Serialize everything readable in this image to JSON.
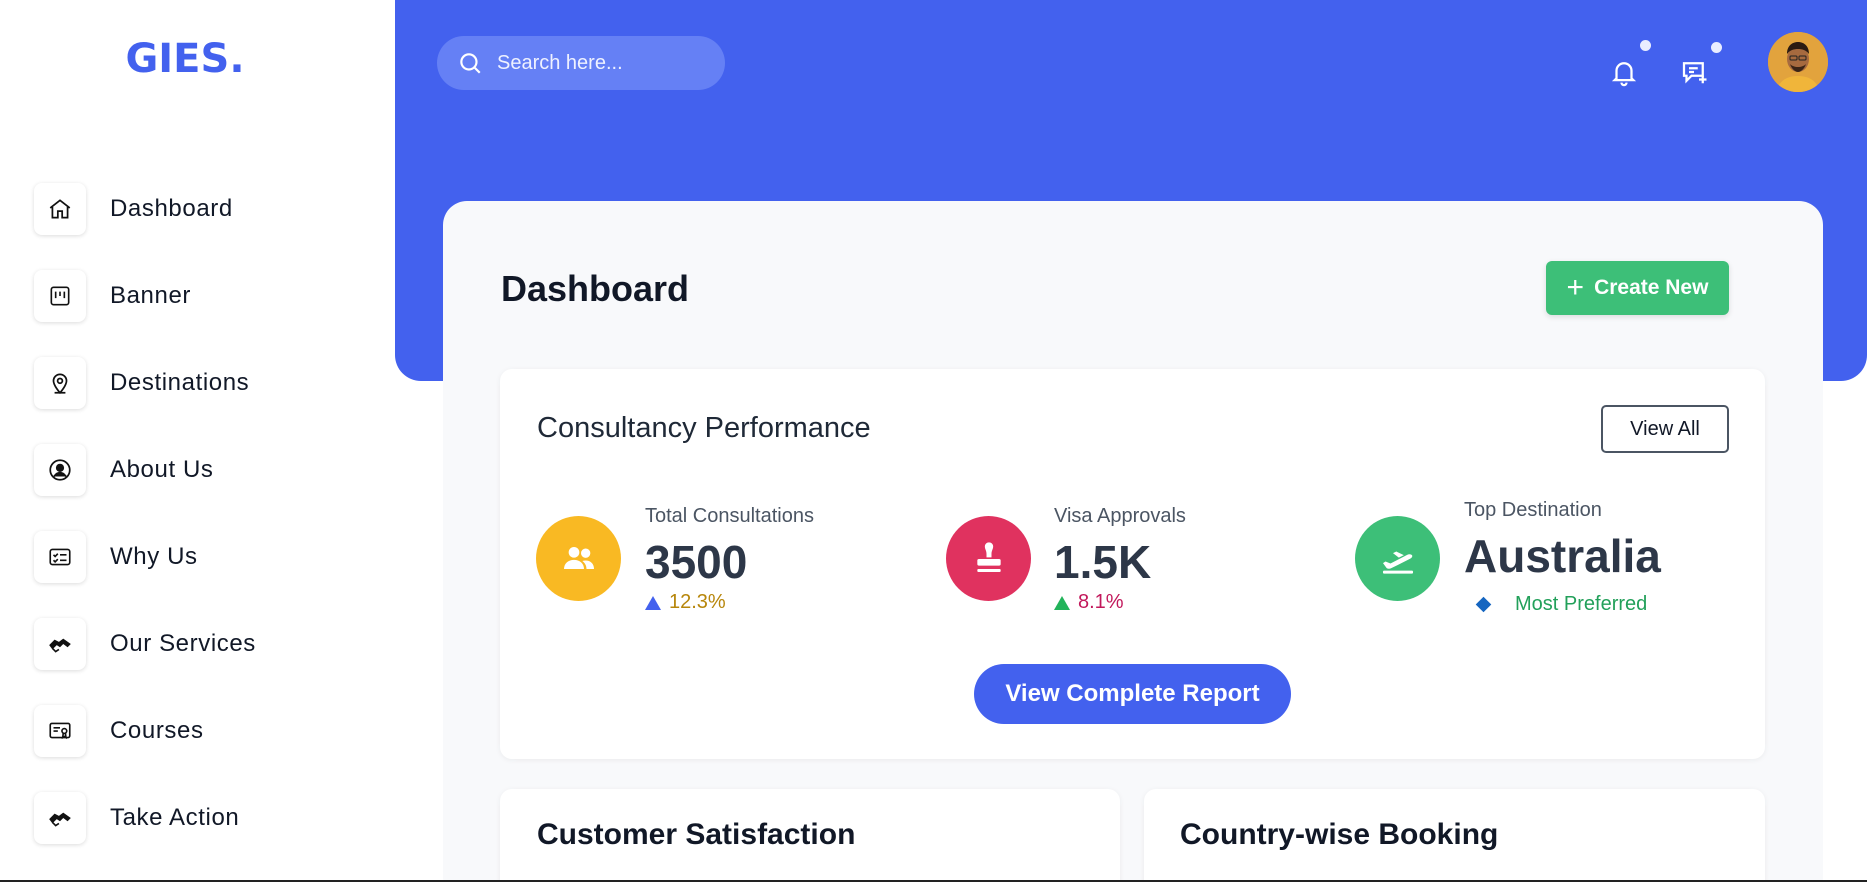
{
  "brand": {
    "logo": "GIES."
  },
  "sidebar": {
    "items": [
      {
        "label": "Dashboard",
        "icon": "home-icon"
      },
      {
        "label": "Banner",
        "icon": "banner-icon"
      },
      {
        "label": "Destinations",
        "icon": "map-pin-icon"
      },
      {
        "label": "About Us",
        "icon": "user-circle-icon"
      },
      {
        "label": "Why Us",
        "icon": "checklist-card-icon"
      },
      {
        "label": "Our Services",
        "icon": "handshake-icon"
      },
      {
        "label": "Courses",
        "icon": "certificate-icon"
      },
      {
        "label": "Take Action",
        "icon": "handshake-icon"
      }
    ]
  },
  "header": {
    "search_placeholder": "Search here...",
    "icons": [
      "bell-icon",
      "message-plus-icon"
    ],
    "accent_color": "#4361ee"
  },
  "main": {
    "title": "Dashboard",
    "create_button": "Create New",
    "performance": {
      "title": "Consultancy Performance",
      "view_all": "View All",
      "stats": [
        {
          "label": "Total Consultations",
          "value": "3500",
          "change": "12.3%",
          "icon": "users-icon",
          "color": "#f9b923",
          "change_color": "#b7860b"
        },
        {
          "label": "Visa Approvals",
          "value": "1.5K",
          "change": "8.1%",
          "icon": "stamp-icon",
          "color": "#e0325f",
          "change_color": "#c2185b"
        },
        {
          "label": "Top Destination",
          "value": "Australia",
          "change": "Most Preferred",
          "icon": "plane-departure-icon",
          "color": "#3dbf78",
          "change_color": "#22a05a"
        }
      ],
      "report_button": "View Complete Report"
    },
    "cards": [
      {
        "title": "Customer Satisfaction"
      },
      {
        "title": "Country-wise Booking"
      }
    ]
  }
}
